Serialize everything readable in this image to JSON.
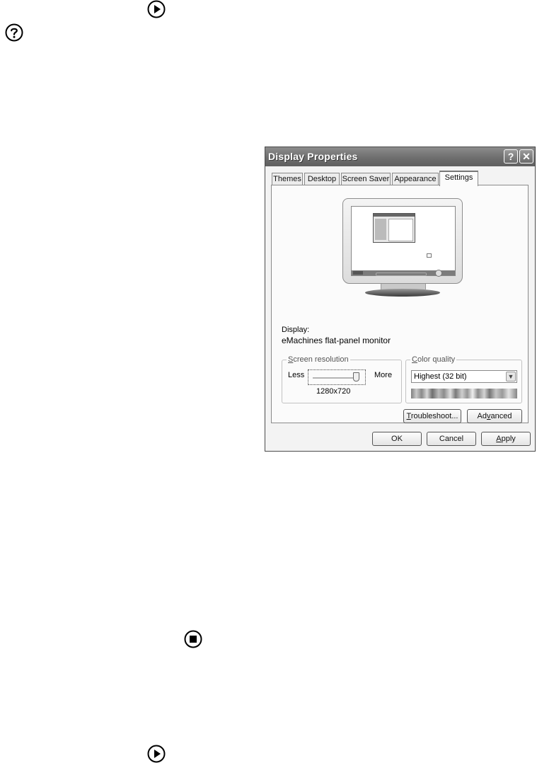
{
  "icons": {
    "top": "play-icon",
    "help": "help-icon",
    "middle": "stop-icon",
    "bottom": "play-icon"
  },
  "dialog": {
    "title": "Display Properties",
    "help_button": "?",
    "close_button": "✕",
    "tabs": [
      {
        "label": "Themes",
        "active": false
      },
      {
        "label": "Desktop",
        "active": false
      },
      {
        "label": "Screen Saver",
        "active": false
      },
      {
        "label": "Appearance",
        "active": false
      },
      {
        "label": "Settings",
        "active": true
      }
    ],
    "display_label": "Display:",
    "display_value": "eMachines flat-panel monitor",
    "resolution": {
      "legend_access": "S",
      "legend_rest": "creen resolution",
      "less": "Less",
      "more": "More",
      "value": "1280x720",
      "slider_level": 1.0
    },
    "color_quality": {
      "legend_access": "C",
      "legend_rest": "olor quality",
      "selected": "Highest (32 bit)"
    },
    "buttons": {
      "troubleshoot_access": "T",
      "troubleshoot_rest": "roubleshoot...",
      "advanced_pre": "Ad",
      "advanced_access": "v",
      "advanced_post": "anced",
      "ok": "OK",
      "cancel": "Cancel",
      "apply_access": "A",
      "apply_rest": "pply"
    }
  }
}
